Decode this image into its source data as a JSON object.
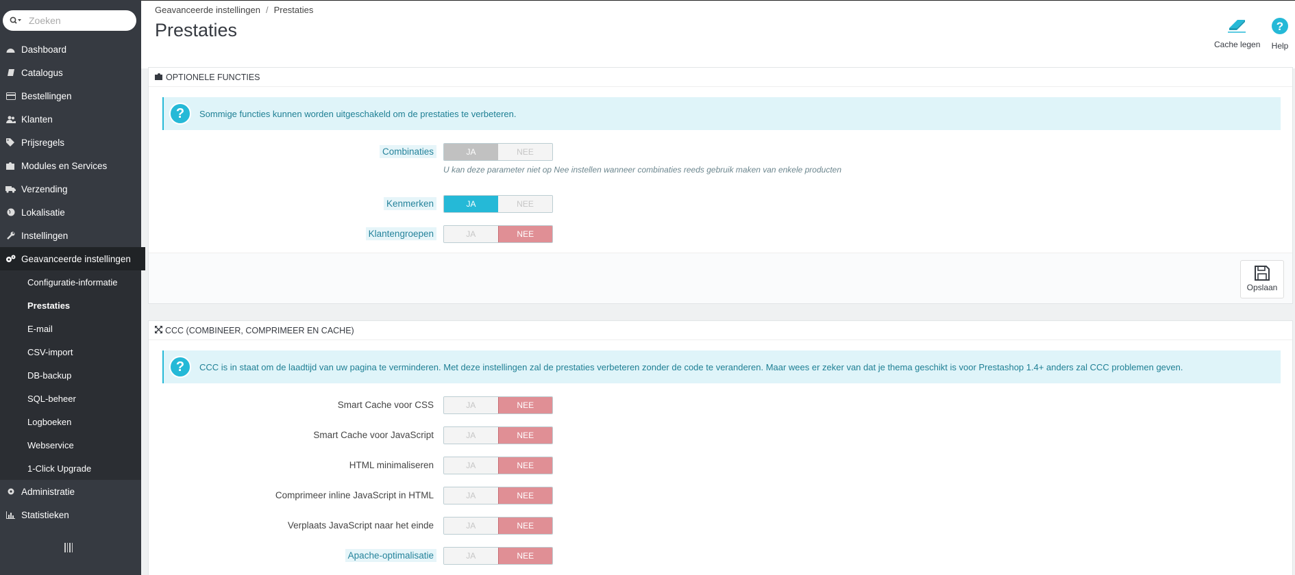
{
  "search": {
    "placeholder": "Zoeken"
  },
  "nav": {
    "items": [
      {
        "label": "Dashboard",
        "icon": "dashboard-icon"
      },
      {
        "label": "Catalogus",
        "icon": "book-icon"
      },
      {
        "label": "Bestellingen",
        "icon": "credit-card-icon"
      },
      {
        "label": "Klanten",
        "icon": "users-icon"
      },
      {
        "label": "Prijsregels",
        "icon": "tags-icon"
      },
      {
        "label": "Modules en Services",
        "icon": "puzzle-icon"
      },
      {
        "label": "Verzending",
        "icon": "truck-icon"
      },
      {
        "label": "Lokalisatie",
        "icon": "globe-icon"
      },
      {
        "label": "Instellingen",
        "icon": "wrench-icon"
      },
      {
        "label": "Geavanceerde instellingen",
        "icon": "gears-icon"
      }
    ],
    "sub": [
      "Configuratie-informatie",
      "Prestaties",
      "E-mail",
      "CSV-import",
      "DB-backup",
      "SQL-beheer",
      "Logboeken",
      "Webservice",
      "1-Click Upgrade"
    ],
    "bottom": [
      {
        "label": "Administratie",
        "icon": "cog-icon"
      },
      {
        "label": "Statistieken",
        "icon": "bar-chart-icon"
      }
    ]
  },
  "header": {
    "breadcrumb": [
      "Geavanceerde instellingen",
      "Prestaties"
    ],
    "title": "Prestaties",
    "cache_label": "Cache legen",
    "help_label": "Help"
  },
  "panel1": {
    "title": "Optionele functies",
    "alert": "Sommige functies kunnen worden uitgeschakeld om de prestaties te verbeteren.",
    "rows": [
      {
        "label": "Combinaties",
        "yes": "JA",
        "no": "NEE",
        "value": "disabled"
      },
      {
        "label": "Kenmerken",
        "yes": "JA",
        "no": "NEE",
        "value": "yes"
      },
      {
        "label": "Klantengroepen",
        "yes": "JA",
        "no": "NEE",
        "value": "no"
      }
    ],
    "combinaties_help": "U kan deze parameter niet op Nee instellen wanneer combinaties reeds gebruik maken van enkele producten",
    "save_label": "Opslaan"
  },
  "panel2": {
    "title": "CCC (Combineer, Comprimeer en Cache)",
    "alert": "CCC is in staat om de laadtijd van uw pagina te verminderen. Met deze instellingen zal de prestaties verbeteren zonder de code te veranderen. Maar wees er zeker van dat je thema geschikt is voor Prestashop 1.4+ anders zal CCC problemen geven.",
    "rows": [
      {
        "label": "Smart Cache voor CSS",
        "yes": "JA",
        "no": "NEE",
        "value": "no"
      },
      {
        "label": "Smart Cache voor JavaScript",
        "yes": "JA",
        "no": "NEE",
        "value": "no"
      },
      {
        "label": "HTML minimaliseren",
        "yes": "JA",
        "no": "NEE",
        "value": "no"
      },
      {
        "label": "Comprimeer inline JavaScript in HTML",
        "yes": "JA",
        "no": "NEE",
        "value": "no"
      },
      {
        "label": "Verplaats JavaScript naar het einde",
        "yes": "JA",
        "no": "NEE",
        "value": "no"
      },
      {
        "label": "Apache-optimalisatie",
        "yes": "JA",
        "no": "NEE",
        "value": "no"
      }
    ]
  },
  "colors": {
    "accent": "#25b9d7",
    "no_active": "#e08f95",
    "sidebar": "#363a41"
  }
}
